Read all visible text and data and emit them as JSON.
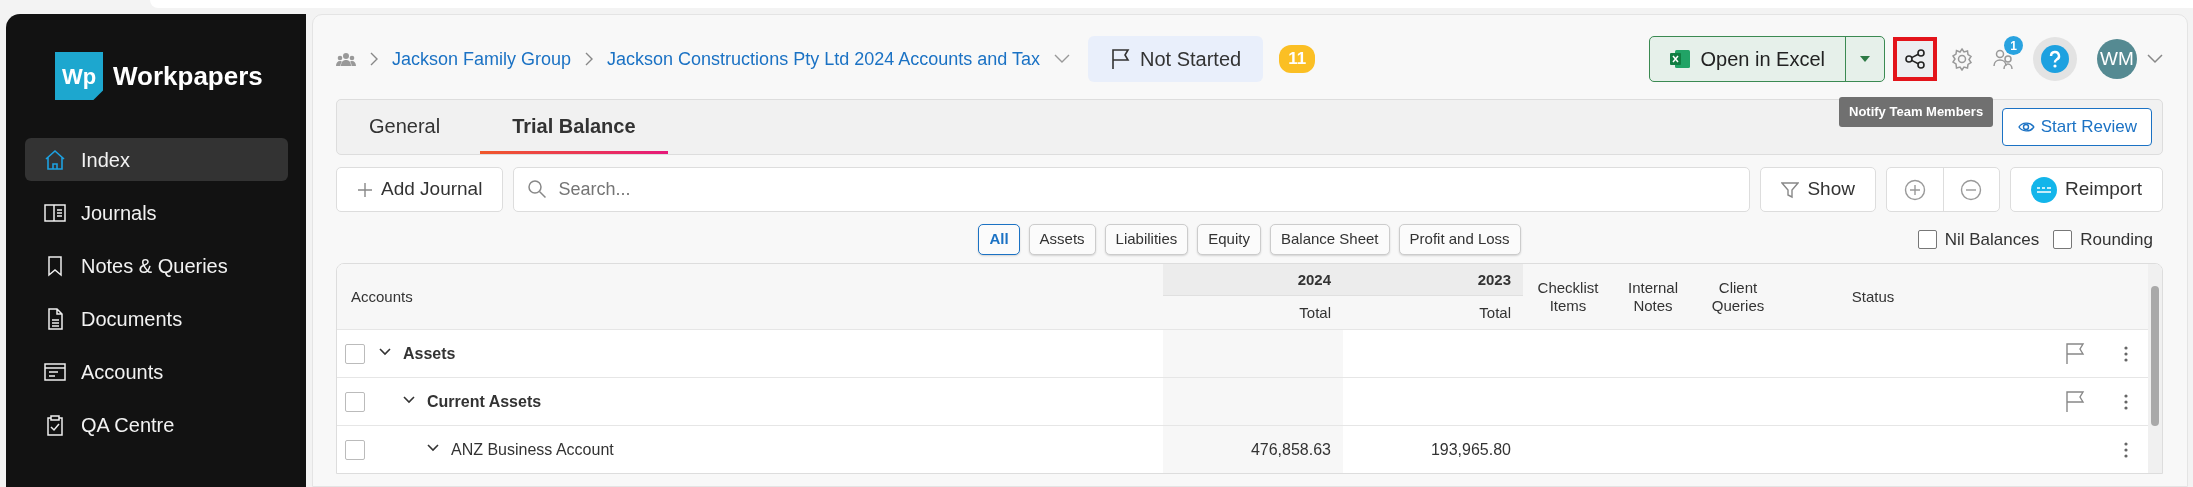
{
  "sidebar": {
    "logo": {
      "mark": "Wp",
      "name": "Workpapers"
    },
    "items": [
      {
        "label": "Index",
        "selected": true
      },
      {
        "label": "Journals",
        "selected": false
      },
      {
        "label": "Notes & Queries",
        "selected": false
      },
      {
        "label": "Documents",
        "selected": false
      },
      {
        "label": "Accounts",
        "selected": false
      },
      {
        "label": "QA Centre",
        "selected": false
      }
    ]
  },
  "breadcrumb": [
    "Jackson Family Group",
    "Jackson Constructions Pty Ltd 2024 Accounts and Tax"
  ],
  "status_button": {
    "label": "Not Started"
  },
  "count_badge": "11",
  "header_actions": {
    "open_excel": "Open in Excel",
    "share": {
      "highlighted": true,
      "tooltip": "Notify Team Members"
    },
    "team_badge": "1",
    "avatar": "WM"
  },
  "tabs": [
    {
      "label": "General",
      "selected": false
    },
    {
      "label": "Trial Balance",
      "selected": true
    }
  ],
  "start_review": "Start Review",
  "toolbar": {
    "add_journal": "Add Journal",
    "search": {
      "placeholder": "Search..."
    },
    "show": "Show",
    "reimport": "Reimport"
  },
  "filters": [
    {
      "label": "All",
      "selected": true
    },
    {
      "label": "Assets",
      "selected": false
    },
    {
      "label": "Liabilities",
      "selected": false
    },
    {
      "label": "Equity",
      "selected": false
    },
    {
      "label": "Balance Sheet",
      "selected": false
    },
    {
      "label": "Profit and Loss",
      "selected": false
    }
  ],
  "options": [
    {
      "label": "Nil Balances",
      "checked": false
    },
    {
      "label": "Rounding",
      "checked": false
    }
  ],
  "table": {
    "columns": {
      "accounts": "Accounts",
      "years": [
        {
          "year": "2024",
          "sub": "Total"
        },
        {
          "year": "2023",
          "sub": "Total"
        }
      ],
      "checklist": "Checklist Items",
      "internal": "Internal Notes",
      "client": "Client Queries",
      "status": "Status"
    },
    "rows": [
      {
        "name": "Assets",
        "kind": "group",
        "expanded": true,
        "flag": true,
        "checked": false,
        "children": [
          {
            "name": "Current Assets",
            "kind": "group",
            "expanded": true,
            "flag": true,
            "checked": false,
            "children": [
              {
                "name": "ANZ Business Account",
                "kind": "account",
                "expanded": true,
                "flag": false,
                "checked": false,
                "values": [
                  "476,858.63",
                  "193,965.80"
                ]
              }
            ]
          }
        ]
      }
    ]
  }
}
